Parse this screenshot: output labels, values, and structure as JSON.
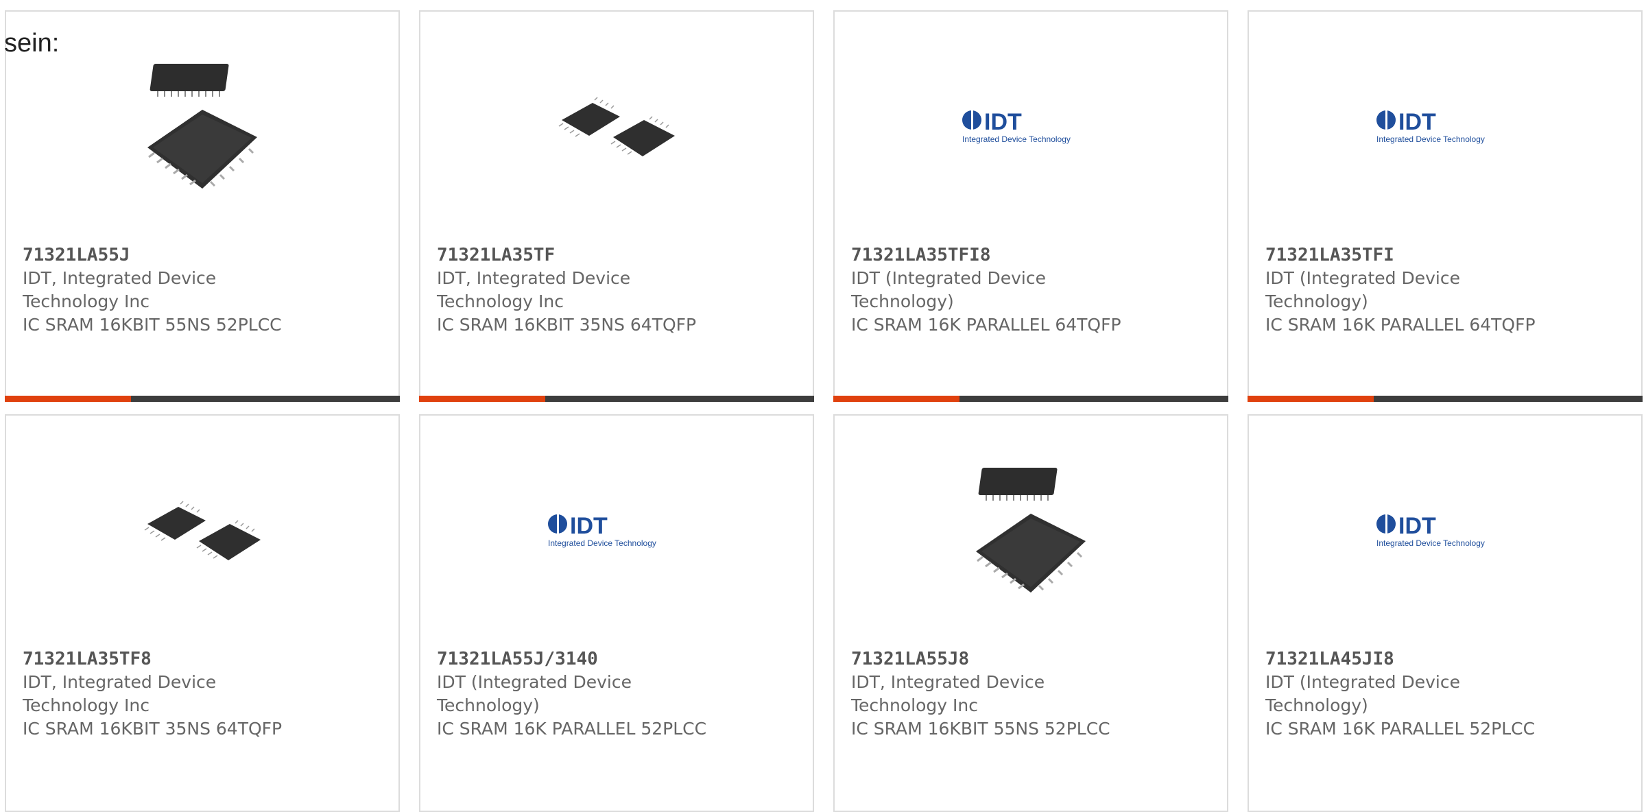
{
  "intro_text": "sein:",
  "cards": [
    {
      "part_number": "71321LA55J",
      "manufacturer": "IDT, Integrated Device Technology Inc",
      "description": "IC SRAM 16KBIT 55NS 52PLCC",
      "image": "plcc-chip-icon",
      "accent_color": "#e0410e"
    },
    {
      "part_number": "71321LA35TF",
      "manufacturer": "IDT, Integrated Device Technology Inc",
      "description": "IC SRAM 16KBIT 35NS 64TQFP",
      "image": "tqfp-chip-icon",
      "accent_color": "#e0410e"
    },
    {
      "part_number": "71321LA35TFI8",
      "manufacturer": "IDT (Integrated Device Technology)",
      "description": "IC SRAM 16K PARALLEL 64TQFP",
      "image": "idt-logo-icon",
      "accent_color": "#e0410e"
    },
    {
      "part_number": "71321LA35TFI",
      "manufacturer": "IDT (Integrated Device Technology)",
      "description": "IC SRAM 16K PARALLEL 64TQFP",
      "image": "idt-logo-icon",
      "accent_color": "#e0410e"
    },
    {
      "part_number": "71321LA35TF8",
      "manufacturer": "IDT, Integrated Device Technology Inc",
      "description": "IC SRAM 16KBIT 35NS 64TQFP",
      "image": "tqfp-chip-icon"
    },
    {
      "part_number": "71321LA55J/3140",
      "manufacturer": "IDT (Integrated Device Technology)",
      "description": "IC SRAM 16K PARALLEL 52PLCC",
      "image": "idt-logo-icon"
    },
    {
      "part_number": "71321LA55J8",
      "manufacturer": "IDT, Integrated Device Technology Inc",
      "description": "IC SRAM 16KBIT 55NS 52PLCC",
      "image": "plcc-chip-icon"
    },
    {
      "part_number": "71321LA45JI8",
      "manufacturer": "IDT (Integrated Device Technology)",
      "description": "IC SRAM 16K PARALLEL 52PLCC",
      "image": "idt-logo-icon"
    }
  ],
  "logo": {
    "brand": "IDT",
    "tagline": "Integrated Device Technology"
  },
  "colors": {
    "accent": "#e0410e",
    "bar": "#3d3d3d",
    "border": "#dcdcdc",
    "logo_blue": "#1f4e9c"
  }
}
